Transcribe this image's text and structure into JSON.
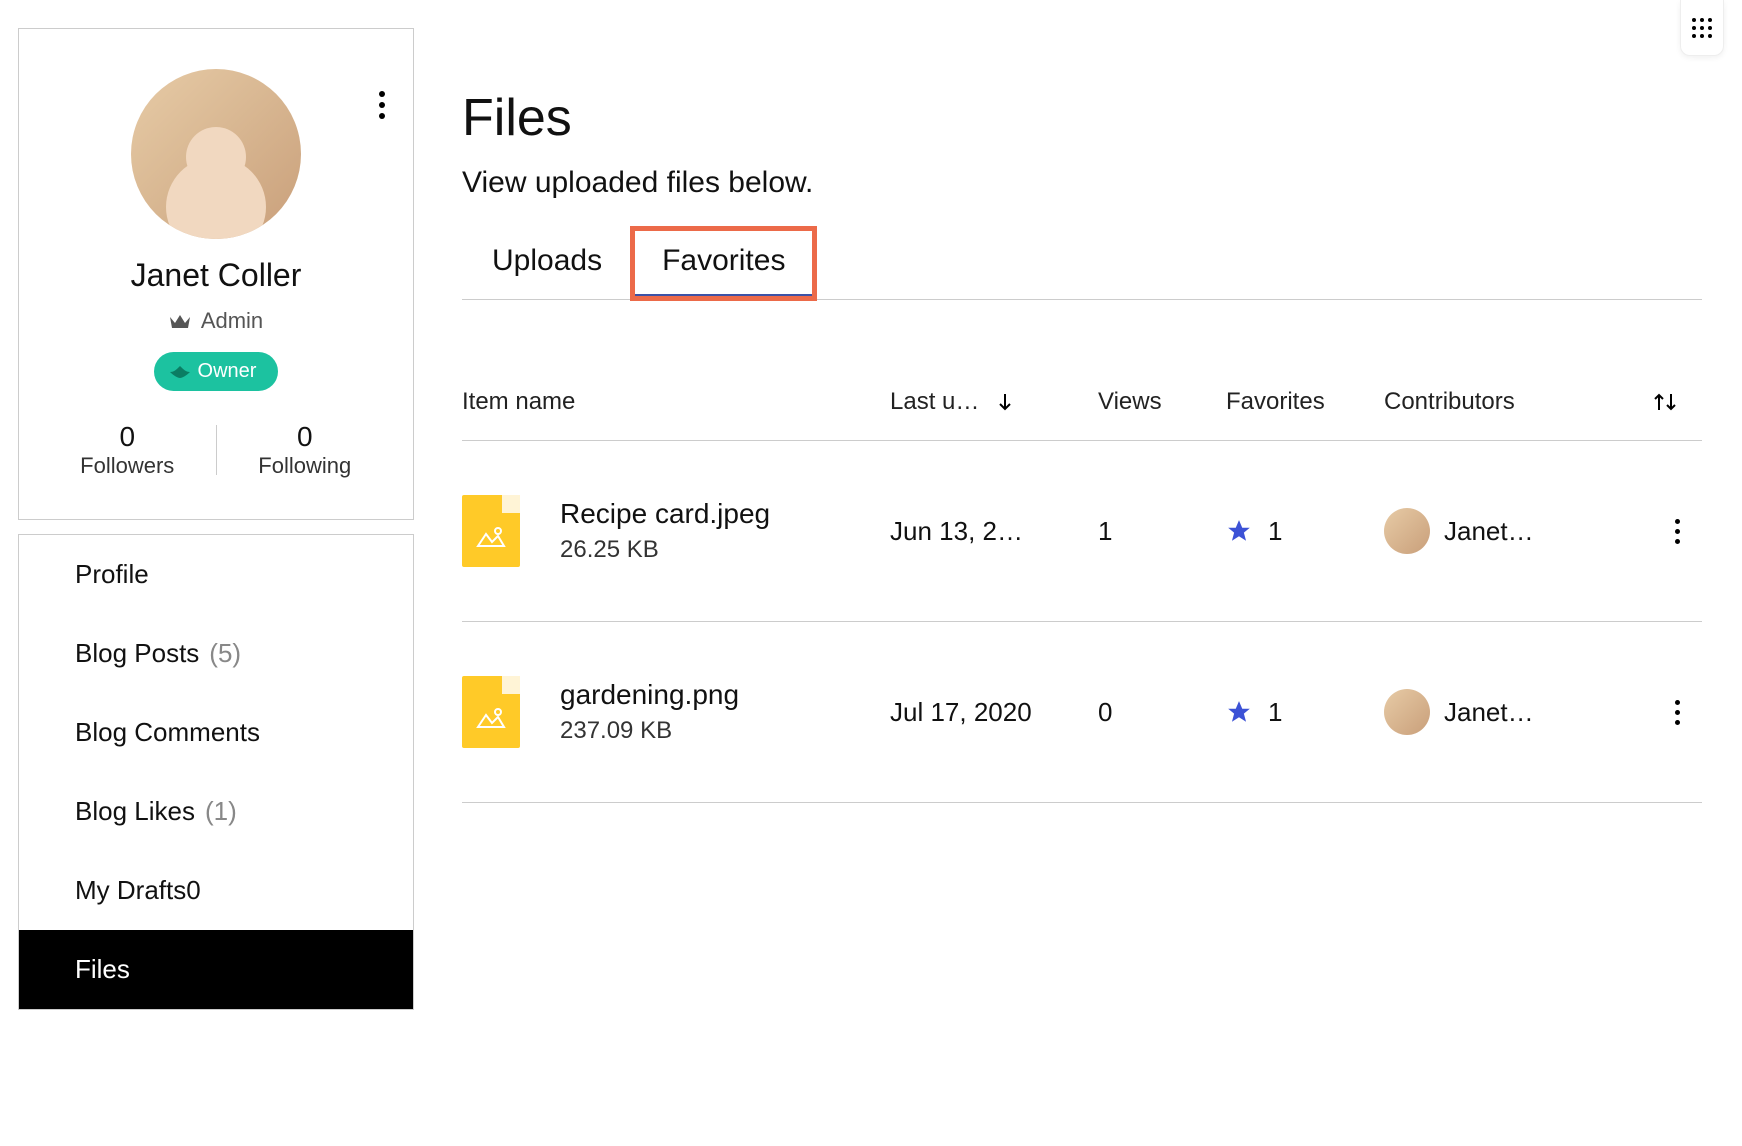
{
  "profile": {
    "name": "Janet Coller",
    "role_label": "Admin",
    "owner_label": "Owner",
    "stats": {
      "followers_count": "0",
      "followers_label": "Followers",
      "following_count": "0",
      "following_label": "Following"
    }
  },
  "nav": {
    "profile": "Profile",
    "blog_posts": "Blog Posts",
    "blog_posts_count": "(5)",
    "blog_comments": "Blog Comments",
    "blog_likes": "Blog Likes",
    "blog_likes_count": "(1)",
    "my_drafts": "My Drafts0",
    "files": "Files"
  },
  "page": {
    "title": "Files",
    "subtitle": "View uploaded files below."
  },
  "tabs": {
    "uploads": "Uploads",
    "favorites": "Favorites"
  },
  "table": {
    "headers": {
      "item": "Item name",
      "last": "Last u…",
      "views": "Views",
      "favorites": "Favorites",
      "contributors": "Contributors"
    },
    "rows": [
      {
        "name": "Recipe card.jpeg",
        "size": "26.25 KB",
        "last": "Jun 13, 2…",
        "views": "1",
        "fav": "1",
        "contributor": "Janet…"
      },
      {
        "name": "gardening.png",
        "size": "237.09 KB",
        "last": "Jul 17, 2020",
        "views": "0",
        "fav": "1",
        "contributor": "Janet…"
      }
    ]
  }
}
